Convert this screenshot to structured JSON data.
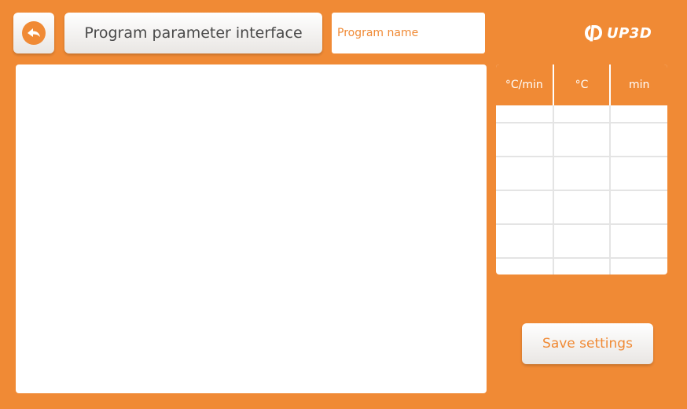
{
  "colors": {
    "accent": "#f08a35",
    "panel": "#ffffff",
    "button_face": "#f4f2f0",
    "title_text": "#4a4a4a",
    "grid_line": "#e4e4e4"
  },
  "header": {
    "back_icon": "back-arrow-icon",
    "title": "Program parameter interface",
    "program_name_placeholder": "Program name",
    "program_name_value": "",
    "logo_text": "UP3D",
    "logo_icon": "up3d-logo-icon"
  },
  "chart_panel": {
    "content": ""
  },
  "parameter_table": {
    "columns": [
      "°C/min",
      "°C",
      "min"
    ],
    "rows": [
      [
        "",
        "",
        ""
      ],
      [
        "",
        "",
        ""
      ],
      [
        "",
        "",
        ""
      ],
      [
        "",
        "",
        ""
      ],
      [
        "",
        "",
        ""
      ],
      [
        "",
        "",
        ""
      ]
    ]
  },
  "actions": {
    "save_label": "Save settings"
  }
}
